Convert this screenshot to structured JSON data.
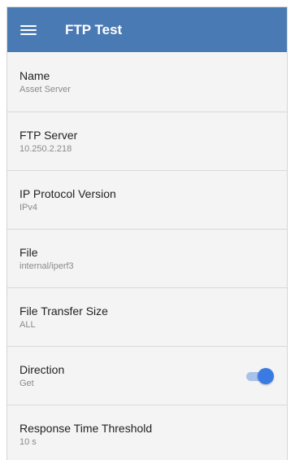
{
  "appbar": {
    "icon": "menu-icon",
    "title": "FTP Test",
    "color": "#4a7ab4"
  },
  "settings": [
    {
      "label": "Name",
      "value": "Asset Server"
    },
    {
      "label": "FTP Server",
      "value": "10.250.2.218"
    },
    {
      "label": "IP Protocol Version",
      "value": "IPv4"
    },
    {
      "label": "File",
      "value": "internal/iperf3"
    },
    {
      "label": "File Transfer Size",
      "value": "ALL"
    },
    {
      "label": "Direction",
      "value": "Get",
      "toggle": {
        "on": true,
        "color": "#3a7be3"
      }
    },
    {
      "label": "Response Time Threshold",
      "value": "10 s"
    }
  ]
}
